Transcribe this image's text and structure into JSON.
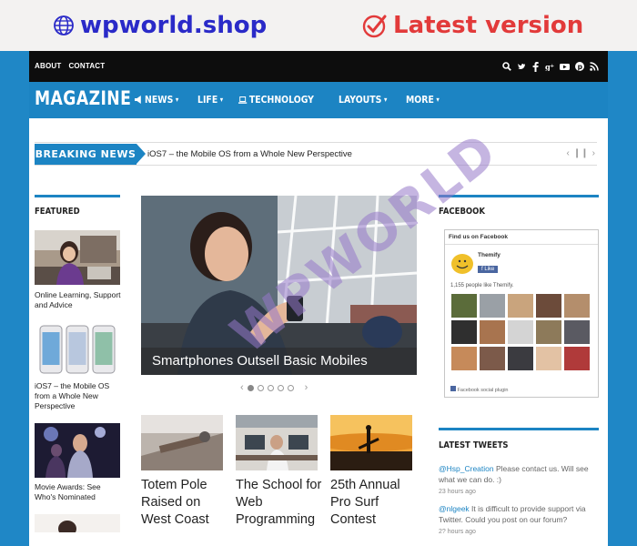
{
  "promo": {
    "brand": "wpworld.shop",
    "badge": "Latest version",
    "brand_icon": "globe-icon",
    "badge_icon": "check-circle-icon",
    "brand_color": "#2a2ac8",
    "badge_color": "#e23a3a"
  },
  "colors": {
    "accent": "#1c84c3",
    "frame": "#1f87c6",
    "topbar": "#0d0d0d"
  },
  "topbar": {
    "links": [
      "ABOUT",
      "CONTACT"
    ],
    "social_icons": [
      "search-icon",
      "twitter-icon",
      "facebook-icon",
      "google-plus-icon",
      "youtube-icon",
      "pinterest-icon",
      "rss-icon"
    ]
  },
  "site": {
    "logo": "MAGAZINE",
    "menu": [
      {
        "label": "NEWS",
        "icon": "megaphone-icon",
        "dropdown": true
      },
      {
        "label": "LIFE",
        "dropdown": true
      },
      {
        "label": "TECHNOLOGY",
        "icon": "laptop-icon",
        "dropdown": false
      },
      {
        "label": "LAYOUTS",
        "dropdown": true
      },
      {
        "label": "MORE",
        "dropdown": true
      }
    ]
  },
  "breaking": {
    "label": "BREAKING NEWS",
    "headline": "iOS7 – the Mobile OS from a Whole New Perspective"
  },
  "featured": {
    "title": "FEATURED",
    "items": [
      {
        "caption": "Online Learning, Support and Advice"
      },
      {
        "caption": "iOS7 – the Mobile OS from a Whole New Perspective"
      },
      {
        "caption": "Movie Awards: See Who's Nominated"
      }
    ]
  },
  "slider": {
    "caption": "Smartphones Outsell Basic Mobiles",
    "slide_count": 5,
    "active_slide": 1
  },
  "articles": [
    {
      "title": "Totem Pole Raised on West Coast"
    },
    {
      "title": "The School for Web Programming"
    },
    {
      "title": "25th Annual Pro Surf Contest"
    }
  ],
  "facebook": {
    "title": "FACEBOOK",
    "header": "Find us on Facebook",
    "page_name": "Themify",
    "like_label": "Like",
    "likes_text": "1,155 people like Themify.",
    "plugin_text": "Facebook social plugin"
  },
  "tweets": {
    "title": "LATEST TWEETS",
    "items": [
      {
        "handle": "@Hsp_Creation",
        "text": " Please contact us. Will see what we can do. :)",
        "time": "23 hours ago"
      },
      {
        "handle": "@nlgeek",
        "text": " It is difficult to provide support via Twitter. Could you post on our forum?",
        "time": "2? hours ago"
      }
    ]
  },
  "watermark": "WPWORLD"
}
